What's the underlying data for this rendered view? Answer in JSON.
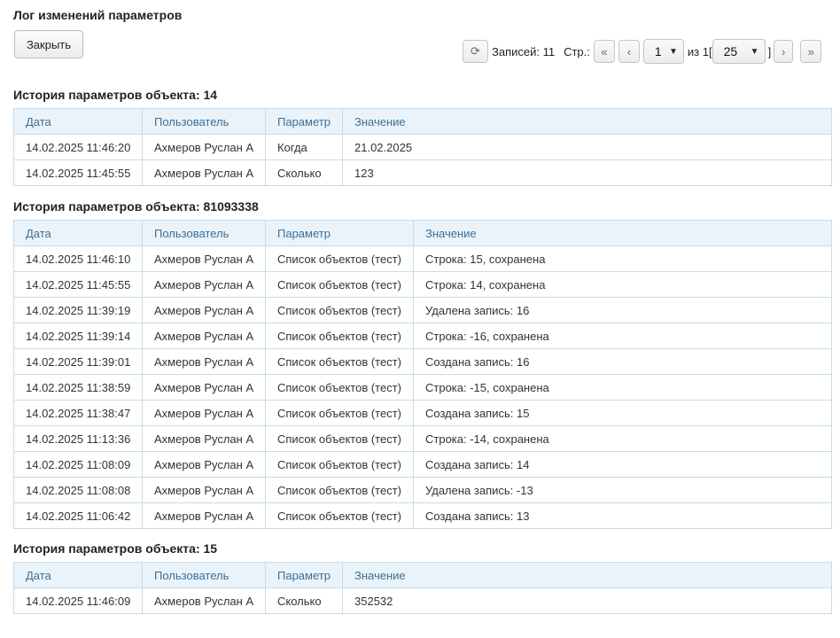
{
  "title": "Лог изменений параметров",
  "close_label": "Закрыть",
  "pager": {
    "records_label": "Записей: 11",
    "page_label": "Стр.:",
    "first_glyph": "«",
    "prev_glyph": "‹",
    "current_page": "1",
    "of_label": "из 1[",
    "page_size": "25",
    "close_bracket": "]",
    "next_glyph": "›",
    "last_glyph": "»",
    "refresh_glyph": "⟳"
  },
  "columns": [
    "Дата",
    "Пользователь",
    "Параметр",
    "Значение"
  ],
  "sections": [
    {
      "title": "История параметров объекта: 14",
      "rows": [
        [
          "14.02.2025 11:46:20",
          "Ахмеров Руслан А",
          "Когда",
          "21.02.2025"
        ],
        [
          "14.02.2025 11:45:55",
          "Ахмеров Руслан А",
          "Сколько",
          "123"
        ]
      ]
    },
    {
      "title": "История параметров объекта: 81093338",
      "rows": [
        [
          "14.02.2025 11:46:10",
          "Ахмеров Руслан А",
          "Список объектов (тест)",
          "Строка: 15, сохранена"
        ],
        [
          "14.02.2025 11:45:55",
          "Ахмеров Руслан А",
          "Список объектов (тест)",
          "Строка: 14, сохранена"
        ],
        [
          "14.02.2025 11:39:19",
          "Ахмеров Руслан А",
          "Список объектов (тест)",
          "Удалена запись: 16"
        ],
        [
          "14.02.2025 11:39:14",
          "Ахмеров Руслан А",
          "Список объектов (тест)",
          "Строка: -16, сохранена"
        ],
        [
          "14.02.2025 11:39:01",
          "Ахмеров Руслан А",
          "Список объектов (тест)",
          "Создана запись: 16"
        ],
        [
          "14.02.2025 11:38:59",
          "Ахмеров Руслан А",
          "Список объектов (тест)",
          "Строка: -15, сохранена"
        ],
        [
          "14.02.2025 11:38:47",
          "Ахмеров Руслан А",
          "Список объектов (тест)",
          "Создана запись: 15"
        ],
        [
          "14.02.2025 11:13:36",
          "Ахмеров Руслан А",
          "Список объектов (тест)",
          "Строка: -14, сохранена"
        ],
        [
          "14.02.2025 11:08:09",
          "Ахмеров Руслан А",
          "Список объектов (тест)",
          "Создана запись: 14"
        ],
        [
          "14.02.2025 11:08:08",
          "Ахмеров Руслан А",
          "Список объектов (тест)",
          "Удалена запись: -13"
        ],
        [
          "14.02.2025 11:06:42",
          "Ахмеров Руслан А",
          "Список объектов (тест)",
          "Создана запись: 13"
        ]
      ]
    },
    {
      "title": "История параметров объекта: 15",
      "rows": [
        [
          "14.02.2025 11:46:09",
          "Ахмеров Руслан А",
          "Сколько",
          "352532"
        ]
      ]
    }
  ]
}
